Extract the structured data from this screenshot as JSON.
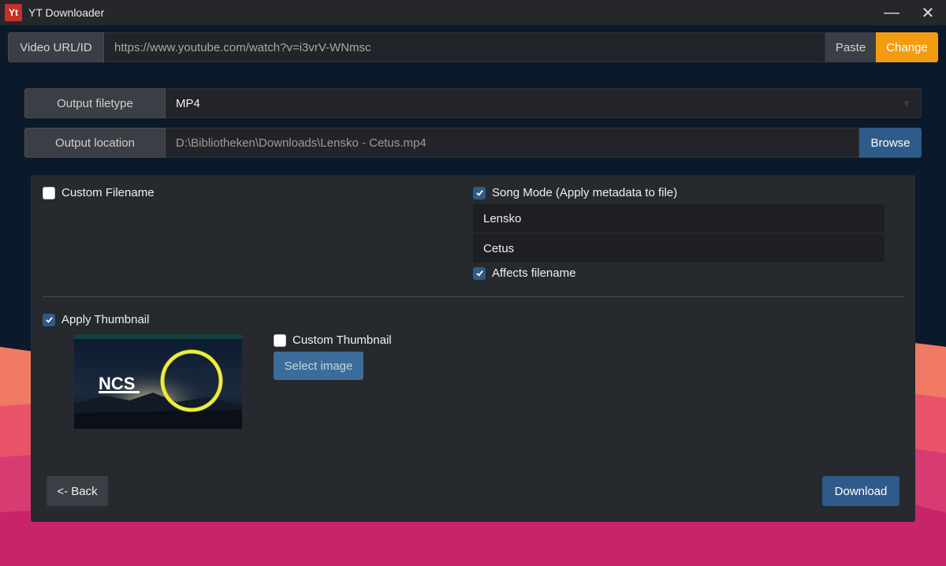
{
  "window": {
    "app_icon_text": "Yt",
    "title": "YT Downloader",
    "minimize_glyph": "—",
    "close_glyph": "✕"
  },
  "url_bar": {
    "label": "Video URL/ID",
    "value": "https://www.youtube.com/watch?v=i3vrV-WNmsc",
    "paste_label": "Paste",
    "change_label": "Change"
  },
  "output": {
    "filetype_label": "Output filetype",
    "filetype_value": "MP4",
    "location_label": "Output location",
    "location_value": "D:\\Bibliotheken\\Downloads\\Lensko - Cetus.mp4",
    "browse_label": "Browse"
  },
  "options": {
    "custom_filename": {
      "label": "Custom Filename",
      "checked": false
    },
    "song_mode": {
      "label": "Song Mode (Apply metadata to file)",
      "checked": true
    },
    "artist_value": "Lensko",
    "song_title_value": "Cetus",
    "affects_filename": {
      "label": "Affects filename",
      "checked": true
    },
    "apply_thumbnail": {
      "label": "Apply Thumbnail",
      "checked": true
    },
    "custom_thumbnail": {
      "label": "Custom Thumbnail",
      "checked": false
    },
    "select_image_label": "Select image"
  },
  "thumbnail": {
    "logo_text": "NCS",
    "accent_color": "#e8e52a"
  },
  "actions": {
    "back_label": "<- Back",
    "download_label": "Download"
  },
  "colors": {
    "accent_blue": "#2f5b8a",
    "accent_orange": "#f39c12",
    "wave_coral": "#ee6b5c",
    "wave_pink": "#d92e6e"
  }
}
